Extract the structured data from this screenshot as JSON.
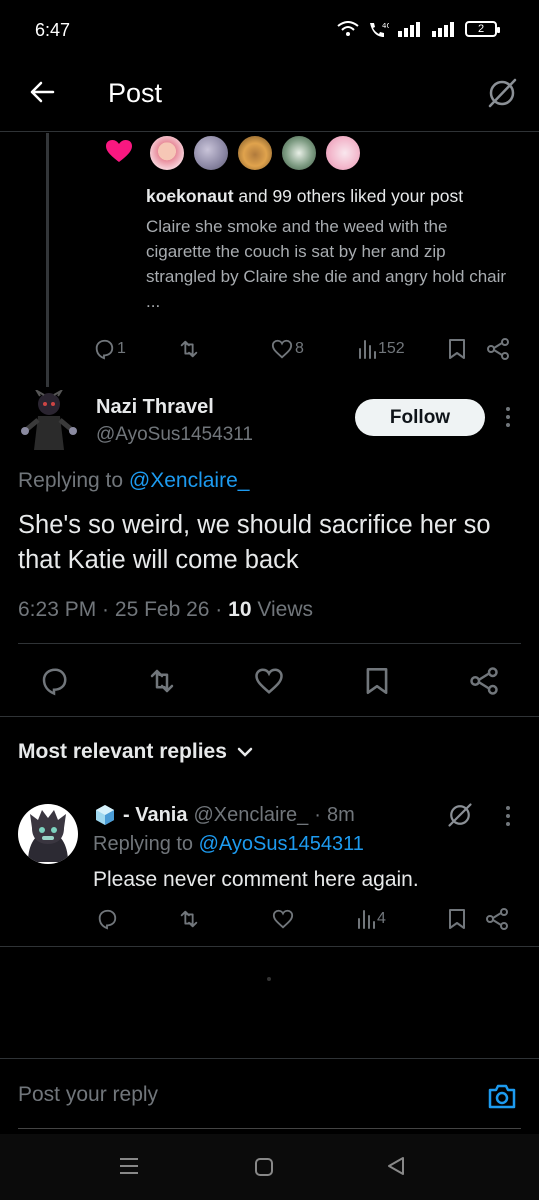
{
  "status_bar": {
    "time": "6:47",
    "battery": "2"
  },
  "header": {
    "title": "Post"
  },
  "notification": {
    "liked_user": "koekonaut",
    "liked_suffix": " and 99 others liked your post",
    "quoted_text": "Claire she smoke and the weed with the cigarette the couch is sat by her and zip strangled by Claire she die and angry hold chair ...",
    "replies": "1",
    "likes": "8",
    "views": "152"
  },
  "post": {
    "author_name": "Nazi Thravel",
    "handle": "@AyoSus1454311",
    "follow_label": "Follow",
    "replying_prefix": "Replying to ",
    "replying_to": "@Xenclaire_",
    "text": "She's so weird, we should sacrifice her so that Katie will come back",
    "time": "6:23 PM",
    "date": "25 Feb 26",
    "views_count": "10",
    "views_label": "Views"
  },
  "replies_section": {
    "title": "Most relevant replies"
  },
  "reply": {
    "name": "- Vania",
    "handle": "@Xenclaire_",
    "age": "8m",
    "replying_prefix": "Replying to ",
    "replying_to": "@AyoSus1454311",
    "text": "Please never comment here again.",
    "views": "4"
  },
  "composer": {
    "placeholder": "Post your reply"
  },
  "colors": {
    "accent": "#1d9bf0",
    "like": "#f91880",
    "background": "#000000"
  }
}
